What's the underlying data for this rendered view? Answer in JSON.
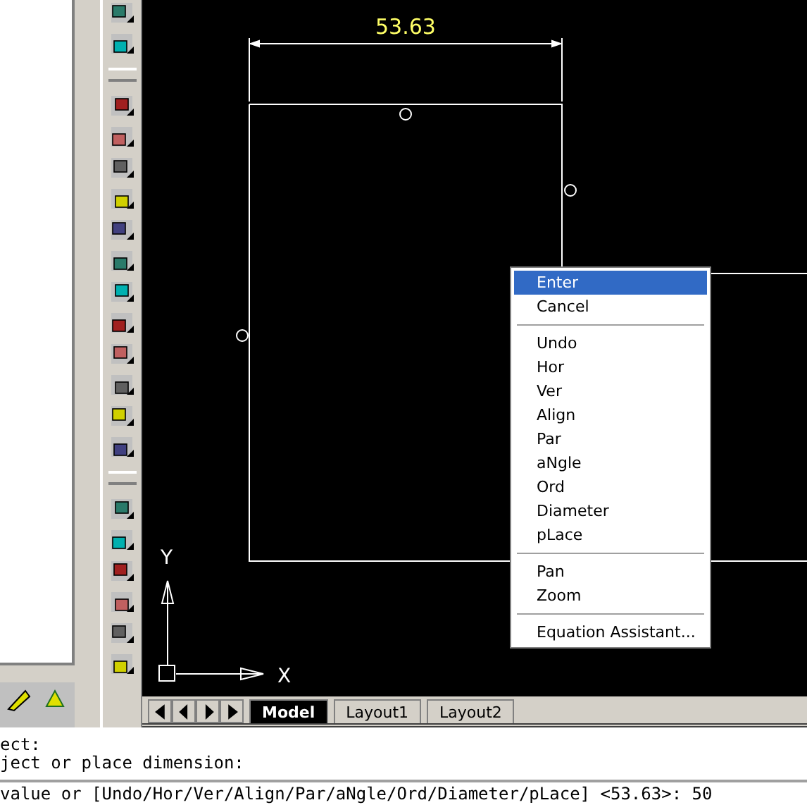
{
  "drawing": {
    "dimension": "53.63",
    "axis_x": "X",
    "axis_y": "Y"
  },
  "context_menu": [
    {
      "kind": "item",
      "label": "Enter",
      "selected": true
    },
    {
      "kind": "item",
      "label": "Cancel",
      "selected": false
    },
    {
      "kind": "separator"
    },
    {
      "kind": "item",
      "label": "Undo",
      "selected": false
    },
    {
      "kind": "item",
      "label": "Hor",
      "selected": false
    },
    {
      "kind": "item",
      "label": "Ver",
      "selected": false
    },
    {
      "kind": "item",
      "label": "Align",
      "selected": false
    },
    {
      "kind": "item",
      "label": "Par",
      "selected": false
    },
    {
      "kind": "item",
      "label": "aNgle",
      "selected": false
    },
    {
      "kind": "item",
      "label": "Ord",
      "selected": false
    },
    {
      "kind": "item",
      "label": "Diameter",
      "selected": false
    },
    {
      "kind": "item",
      "label": "pLace",
      "selected": false
    },
    {
      "kind": "separator"
    },
    {
      "kind": "item",
      "label": "Pan",
      "selected": false
    },
    {
      "kind": "item",
      "label": "Zoom",
      "selected": false
    },
    {
      "kind": "separator"
    },
    {
      "kind": "item",
      "label": "Equation Assistant...",
      "selected": false
    }
  ],
  "tabs": [
    {
      "label": "Model",
      "selected": true
    },
    {
      "label": "Layout1",
      "selected": false
    },
    {
      "label": "Layout2",
      "selected": false
    }
  ],
  "command_history": [
    "ect:",
    "ject or place dimension:"
  ],
  "command_line": "value or [Undo/Hor/Ver/Align/Par/aNgle/Ord/Diameter/pLace] <53.63>: 50"
}
